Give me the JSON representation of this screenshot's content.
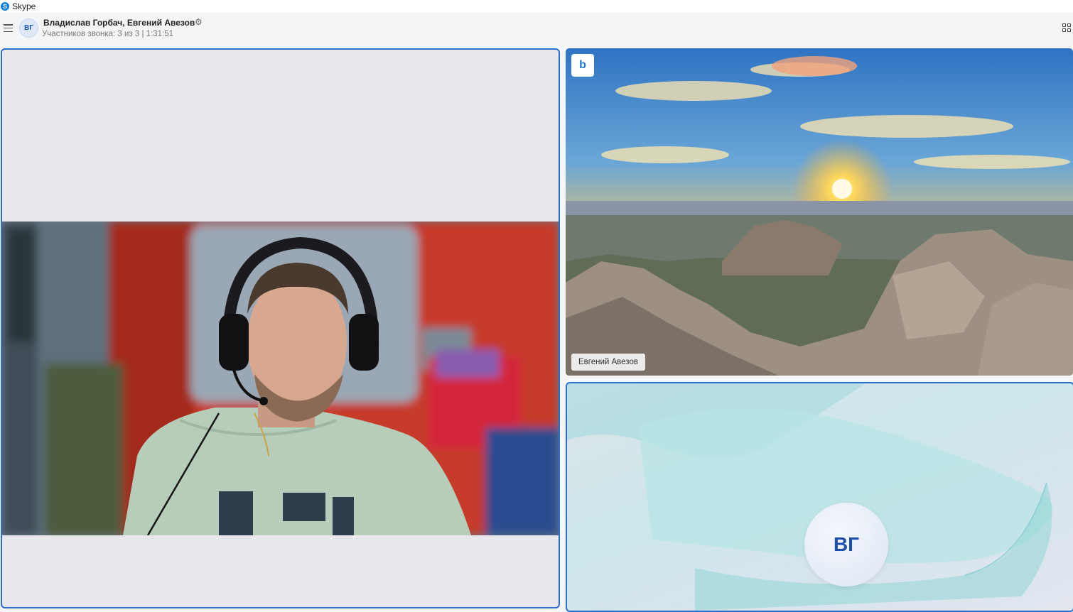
{
  "app": {
    "title": "Skype",
    "logo_letter": "S"
  },
  "header": {
    "avatar_initials": "ВГ",
    "title": "Владислав Горбач, Евгений Авезов",
    "subtitle": "Участников звонка: 3 из 3 | 1:31:51"
  },
  "tiles": {
    "top_right": {
      "name": "Евгений Авезов",
      "bing_letter": "b"
    },
    "bottom_right": {
      "avatar_initials": "ВГ"
    }
  },
  "colors": {
    "accent": "#2a6fd1",
    "skype": "#0a7fdc"
  }
}
